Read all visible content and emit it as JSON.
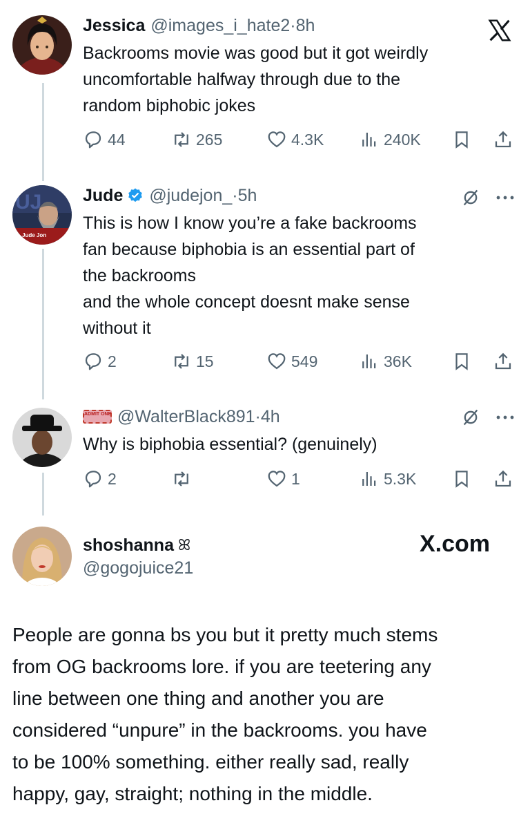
{
  "tweets": [
    {
      "name": "Jessica",
      "handle": "@images_i_hate2",
      "time": "8h",
      "text_lines": [
        "Backrooms movie was good but it got weirdly",
        "uncomfortable halfway through due to the",
        "random biphobic jokes"
      ],
      "replies": "44",
      "reposts": "265",
      "likes": "4.3K",
      "views": "240K"
    },
    {
      "name": "Jude",
      "handle": "@judejon_",
      "time": "5h",
      "avatar_caption": "Jude Jon",
      "text_lines": [
        "This is how I know you’re a fake backrooms",
        "fan because biphobia is an essential part of",
        "the backrooms",
        "and the whole concept doesnt make sense",
        "without it"
      ],
      "replies": "2",
      "reposts": "15",
      "likes": "549",
      "views": "36K"
    },
    {
      "name": "",
      "badge_text": "ADMIT ONE",
      "handle": "@WalterBlack891",
      "time": "4h",
      "text_lines": [
        "Why is biphobia essential? (genuinely)"
      ],
      "replies": "2",
      "reposts": "",
      "likes": "1",
      "views": "5.3K"
    }
  ],
  "reply": {
    "name": "shoshanna",
    "name_symbol": "ꕤ",
    "handle": "@gogojuice21",
    "source": "X.com",
    "text_lines": [
      "People are gonna bs you but it pretty much stems",
      "from OG backrooms lore. if you are teetering any",
      "line between one thing and another you are",
      "considered “unpure” in the backrooms. you have",
      "to be 100% something. either really sad, really",
      "happy, gay, straight; nothing in the middle."
    ]
  },
  "separator": "·",
  "icons": [
    "x-logo-icon",
    "reply-icon",
    "repost-icon",
    "like-icon",
    "views-icon",
    "bookmark-icon",
    "share-icon",
    "grok-icon",
    "more-icon",
    "verified-icon"
  ],
  "colors": {
    "text": "#0f1419",
    "secondary": "#536471",
    "thread_line": "#cfd9de",
    "verified": "#1d9bf0"
  }
}
